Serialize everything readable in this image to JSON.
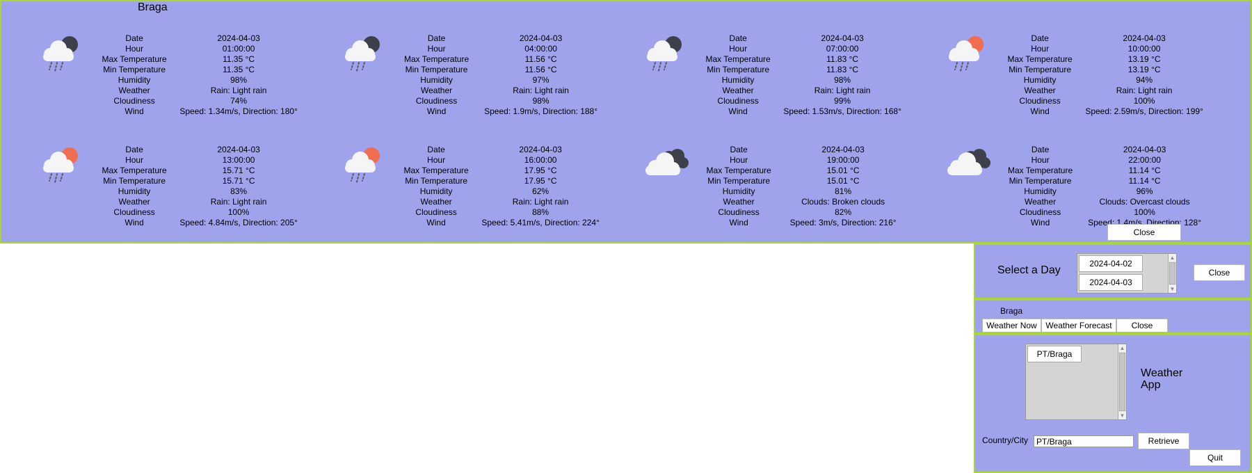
{
  "forecast": {
    "city": "Braga",
    "field_labels": {
      "date": "Date",
      "hour": "Hour",
      "max_temp": "Max Temperature",
      "min_temp": "Min Temperature",
      "humidity": "Humidity",
      "weather": "Weather",
      "cloudiness": "Cloudiness",
      "wind": "Wind"
    },
    "entries": [
      {
        "icon": "rain-night-icon",
        "date": "2024-04-03",
        "hour": "01:00:00",
        "max_temp": "11.35 °C",
        "min_temp": "11.35 °C",
        "humidity": "98%",
        "weather": "Rain: Light rain",
        "cloudiness": "74%",
        "wind": "Speed: 1.34m/s, Direction: 180°"
      },
      {
        "icon": "rain-night-icon",
        "date": "2024-04-03",
        "hour": "04:00:00",
        "max_temp": "11.56 °C",
        "min_temp": "11.56 °C",
        "humidity": "97%",
        "weather": "Rain: Light rain",
        "cloudiness": "98%",
        "wind": "Speed: 1.9m/s, Direction: 188°"
      },
      {
        "icon": "rain-night-icon",
        "date": "2024-04-03",
        "hour": "07:00:00",
        "max_temp": "11.83 °C",
        "min_temp": "11.83 °C",
        "humidity": "98%",
        "weather": "Rain: Light rain",
        "cloudiness": "99%",
        "wind": "Speed: 1.53m/s, Direction: 168°"
      },
      {
        "icon": "rain-day-icon",
        "date": "2024-04-03",
        "hour": "10:00:00",
        "max_temp": "13.19 °C",
        "min_temp": "13.19 °C",
        "humidity": "94%",
        "weather": "Rain: Light rain",
        "cloudiness": "100%",
        "wind": "Speed: 2.59m/s, Direction: 199°"
      },
      {
        "icon": "rain-day-icon",
        "date": "2024-04-03",
        "hour": "13:00:00",
        "max_temp": "15.71 °C",
        "min_temp": "15.71 °C",
        "humidity": "83%",
        "weather": "Rain: Light rain",
        "cloudiness": "100%",
        "wind": "Speed: 4.84m/s, Direction: 205°"
      },
      {
        "icon": "rain-day-icon",
        "date": "2024-04-03",
        "hour": "16:00:00",
        "max_temp": "17.95 °C",
        "min_temp": "17.95 °C",
        "humidity": "62%",
        "weather": "Rain: Light rain",
        "cloudiness": "88%",
        "wind": "Speed: 5.41m/s, Direction: 224°"
      },
      {
        "icon": "broken-clouds-icon",
        "date": "2024-04-03",
        "hour": "19:00:00",
        "max_temp": "15.01 °C",
        "min_temp": "15.01 °C",
        "humidity": "81%",
        "weather": "Clouds: Broken clouds",
        "cloudiness": "82%",
        "wind": "Speed: 3m/s, Direction: 216°"
      },
      {
        "icon": "broken-clouds-icon",
        "date": "2024-04-03",
        "hour": "22:00:00",
        "max_temp": "11.14 °C",
        "min_temp": "11.14 °C",
        "humidity": "96%",
        "weather": "Clouds: Overcast clouds",
        "cloudiness": "100%",
        "wind": "Speed: 1.4m/s, Direction: 128°"
      }
    ],
    "close_label": "Close"
  },
  "day_selector": {
    "title": "Select a Day",
    "days": [
      "2024-04-02",
      "2024-04-03"
    ],
    "close_label": "Close"
  },
  "city_bar": {
    "city": "Braga",
    "weather_now_label": "Weather Now",
    "weather_forecast_label": "Weather Forecast",
    "close_label": "Close"
  },
  "app": {
    "title_line1": "Weather",
    "title_line2": "App",
    "locations": [
      "PT/Braga"
    ],
    "country_city_label": "Country/City",
    "country_city_value": "PT/Braga",
    "retrieve_label": "Retrieve",
    "quit_label": "Quit"
  },
  "colors": {
    "panel_bg": "#9ea3ec",
    "panel_border": "#a8d82e",
    "cloud": "#f5f5f5",
    "dark_cloud": "#3d3f4a",
    "moon": "#3d3f4a",
    "sun": "#f06d4f",
    "rain": "#555a66"
  }
}
